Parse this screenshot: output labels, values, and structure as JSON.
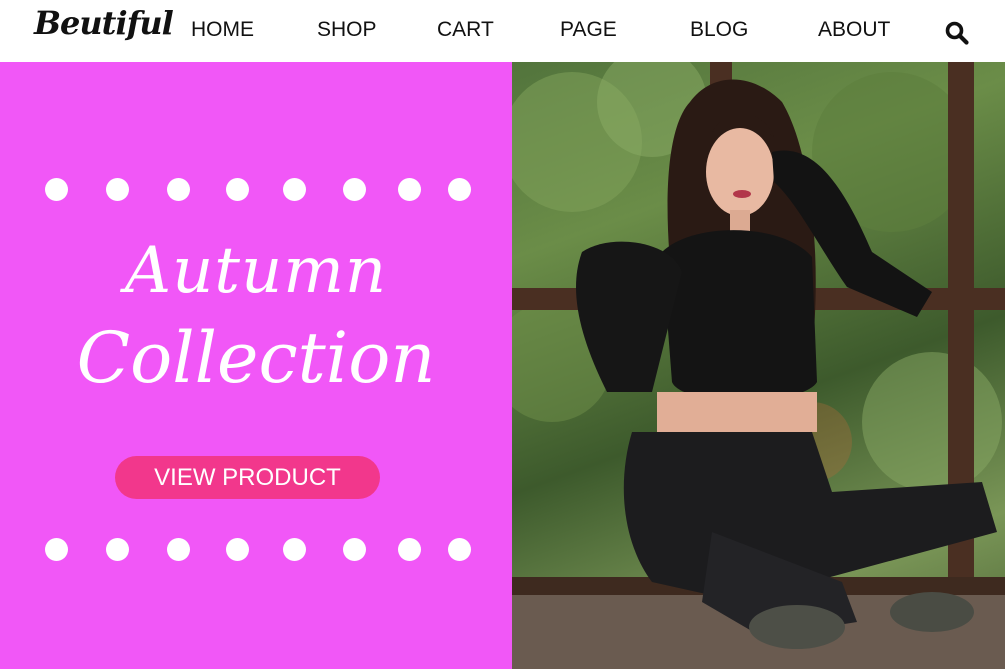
{
  "brand": {
    "logo_text": "Beutiful"
  },
  "nav": {
    "items": [
      {
        "label": "HOME"
      },
      {
        "label": "SHOP"
      },
      {
        "label": "CART"
      },
      {
        "label": "PAGE"
      },
      {
        "label": "BLOG"
      },
      {
        "label": "ABOUT"
      }
    ],
    "search_icon": "search-icon"
  },
  "hero": {
    "title_line1": "Autumn",
    "title_line2": "Collection",
    "cta_label": "VIEW PRODUCT",
    "image": "model-photo"
  },
  "colors": {
    "hero_background": "#f157f7",
    "cta_background": "#f2378c",
    "text_dark": "#111111",
    "text_light": "#ffffff"
  }
}
